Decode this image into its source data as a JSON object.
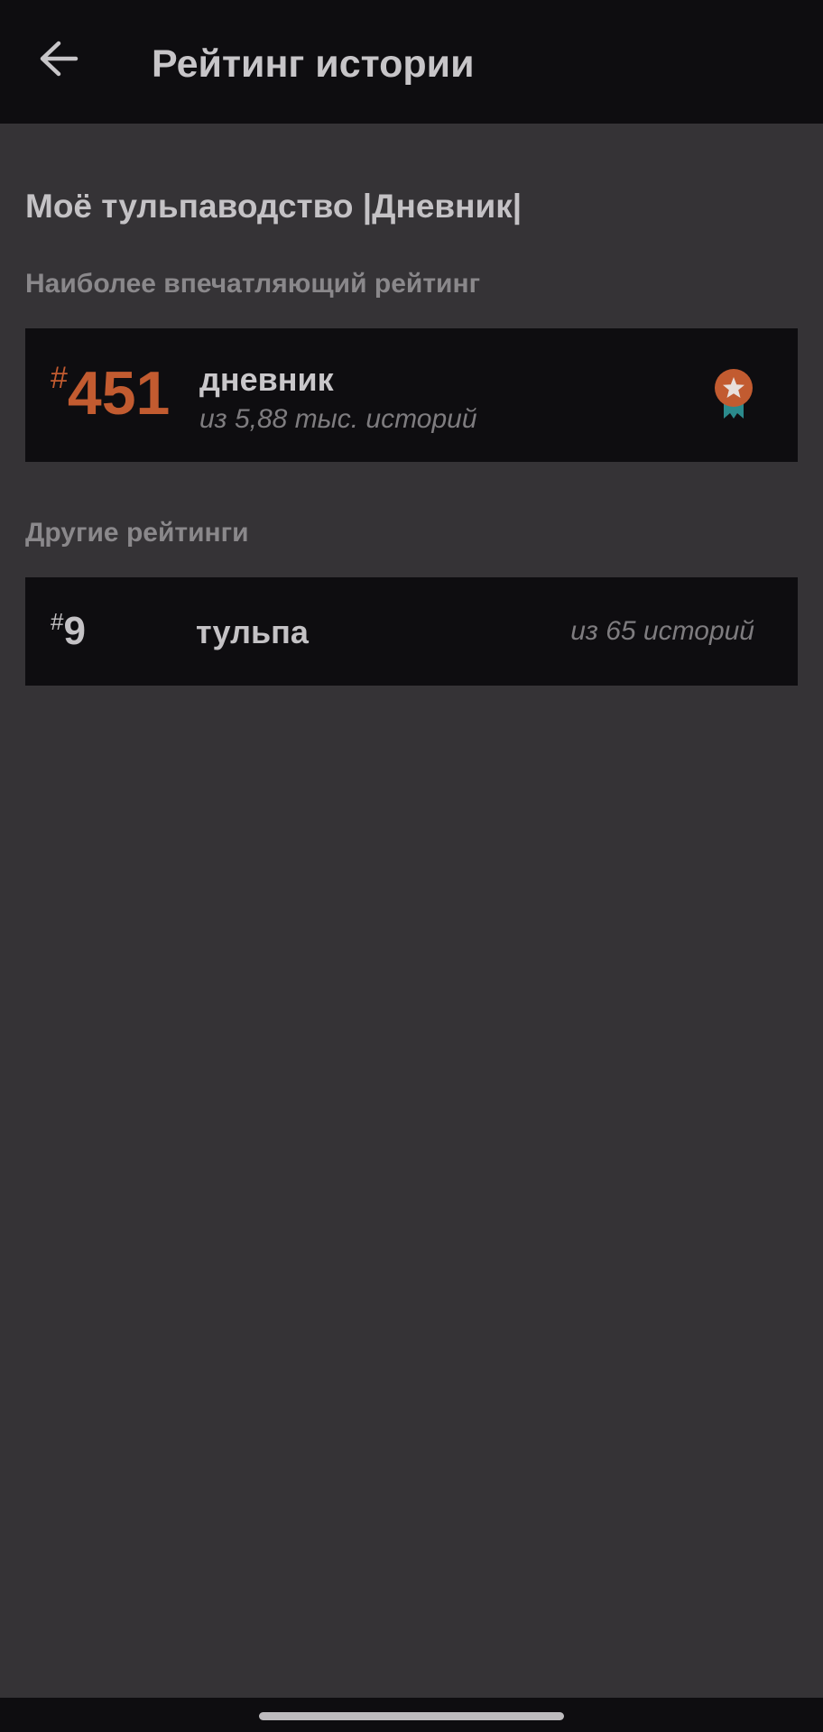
{
  "app_bar": {
    "title": "Рейтинг истории",
    "back_icon": "arrow-left-icon"
  },
  "story": {
    "title": "Моё тульпаводство |Дневник|"
  },
  "best_ranking": {
    "section_label": "Наиболее впечатляющий рейтинг",
    "hash": "#",
    "rank": "451",
    "tag": "дневник",
    "subtitle": "из 5,88 тыс. историй",
    "badge_icon": "award-ribbon-icon",
    "accent_color": "#c25b30"
  },
  "other_rankings": {
    "section_label": "Другие рейтинги",
    "items": [
      {
        "hash": "#",
        "rank": "9",
        "tag": "тульпа",
        "subtitle": "из 65 историй"
      }
    ]
  },
  "colors": {
    "background": "#353336",
    "surface": "#0e0d10"
  }
}
